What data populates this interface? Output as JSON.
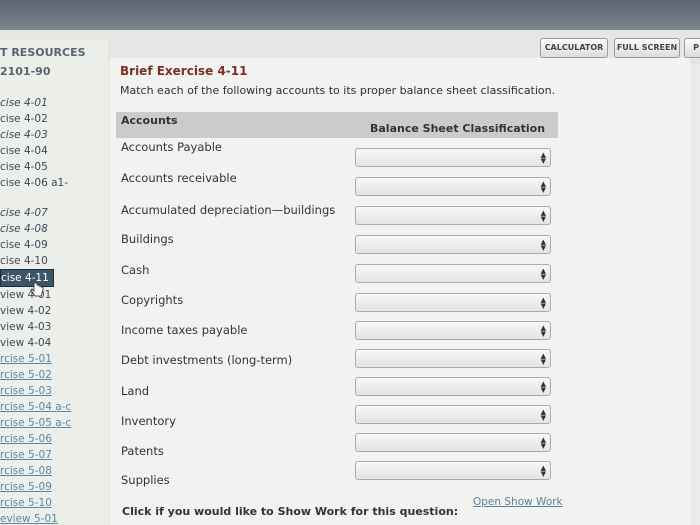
{
  "toolbar": {
    "calculator": "CALCULATOR",
    "fullscreen": "FULL SCREEN",
    "print": "P"
  },
  "sidebar": {
    "resources": "T RESOURCES",
    "course": "2101-90",
    "items": [
      {
        "label": "cise 4-01"
      },
      {
        "label": "cise 4-02"
      },
      {
        "label": "cise 4-03"
      },
      {
        "label": "cise 4-04"
      },
      {
        "label": "cise 4-05"
      },
      {
        "label": "cise 4-06 a1-"
      },
      {
        "label": "cise 4-07"
      },
      {
        "label": "cise 4-08"
      },
      {
        "label": "cise 4-09"
      },
      {
        "label": "cise 4-10"
      },
      {
        "label": "cise 4-11"
      },
      {
        "label": "view 4-01"
      },
      {
        "label": "view 4-02"
      },
      {
        "label": "view 4-03"
      },
      {
        "label": "view 4-04"
      },
      {
        "label": "rcise 5-01"
      },
      {
        "label": "rcise 5-02"
      },
      {
        "label": "rcise 5-03"
      },
      {
        "label": "rcise 5-04 a-c"
      },
      {
        "label": "rcise 5-05 a-c"
      },
      {
        "label": "rcise 5-06"
      },
      {
        "label": "rcise 5-07"
      },
      {
        "label": "rcise 5-08"
      },
      {
        "label": "rcise 5-09"
      },
      {
        "label": "rcise 5-10"
      },
      {
        "label": "eview 5-01"
      }
    ]
  },
  "exercise": {
    "title": "Brief Exercise 4-11",
    "instruction": "Match each of the following accounts to its proper balance sheet classification.",
    "col_accounts": "Accounts",
    "col_classification": "Balance Sheet Classification",
    "rows": [
      {
        "account": "Accounts Payable",
        "selected": ""
      },
      {
        "account": "Accounts receivable",
        "selected": ""
      },
      {
        "account": "Accumulated depreciation—buildings",
        "selected": ""
      },
      {
        "account": "Buildings",
        "selected": ""
      },
      {
        "account": "Cash",
        "selected": ""
      },
      {
        "account": "Copyrights",
        "selected": ""
      },
      {
        "account": "Income taxes payable",
        "selected": ""
      },
      {
        "account": "Debt investments (long-term)",
        "selected": ""
      },
      {
        "account": "Land",
        "selected": ""
      },
      {
        "account": "Inventory",
        "selected": ""
      },
      {
        "account": "Patents",
        "selected": ""
      },
      {
        "account": "Supplies",
        "selected": ""
      }
    ],
    "footer_text": "Click if you would like to Show Work for this question:",
    "footer_link": "Open Show Work"
  },
  "colors": {
    "title": "#7a2e26",
    "active_item_bg": "#3d5566",
    "link": "#5a7f98"
  },
  "icons": [
    "select-arrow-icon",
    "hand-cursor-icon"
  ]
}
